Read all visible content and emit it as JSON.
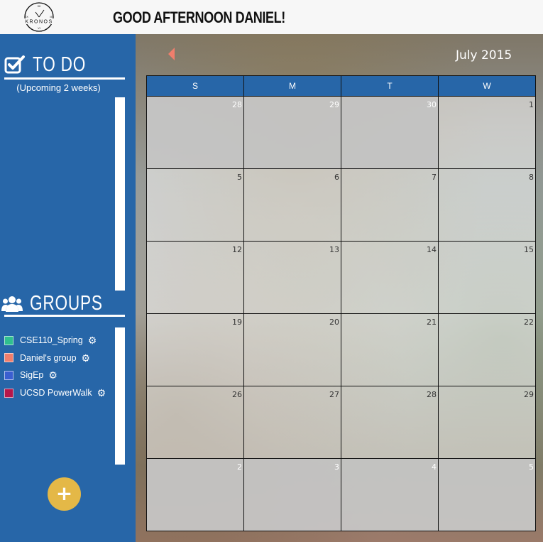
{
  "header": {
    "logo_word": "KRONOS",
    "logo_numerals": [
      "XII",
      "III",
      "VI",
      "IX"
    ],
    "greeting": "GOOD AFTERNOON DANIEL!"
  },
  "sidebar": {
    "todo": {
      "title": "TO DO",
      "subtitle": "(Upcoming 2 weeks)",
      "icon": "checkbox-icon"
    },
    "groups": {
      "title": "GROUPS",
      "icon": "users-icon",
      "items": [
        {
          "name": "CSE110_Spring",
          "color": "#2fbf8f"
        },
        {
          "name": "Daniel's group",
          "color": "#f07e6c"
        },
        {
          "name": "SigEp",
          "color": "#3b5fd0"
        },
        {
          "name": "UCSD PowerWalk",
          "color": "#b5164a"
        }
      ]
    },
    "add_button": {
      "label": "+",
      "color": "#e4b847"
    }
  },
  "calendar": {
    "month_title": "July 2015",
    "weekdays": [
      "S",
      "M",
      "T",
      "W"
    ],
    "weeks": [
      [
        {
          "day": "28",
          "muted": true
        },
        {
          "day": "29",
          "muted": true
        },
        {
          "day": "30",
          "muted": true
        },
        {
          "day": "1",
          "muted": false
        }
      ],
      [
        {
          "day": "5",
          "muted": false
        },
        {
          "day": "6",
          "muted": false
        },
        {
          "day": "7",
          "muted": false
        },
        {
          "day": "8",
          "muted": false
        }
      ],
      [
        {
          "day": "12",
          "muted": false
        },
        {
          "day": "13",
          "muted": false
        },
        {
          "day": "14",
          "muted": false
        },
        {
          "day": "15",
          "muted": false
        }
      ],
      [
        {
          "day": "19",
          "muted": false
        },
        {
          "day": "20",
          "muted": false
        },
        {
          "day": "21",
          "muted": false
        },
        {
          "day": "22",
          "muted": false
        }
      ],
      [
        {
          "day": "26",
          "muted": false
        },
        {
          "day": "27",
          "muted": false
        },
        {
          "day": "28",
          "muted": false
        },
        {
          "day": "29",
          "muted": false
        }
      ],
      [
        {
          "day": "2",
          "muted": true
        },
        {
          "day": "3",
          "muted": true
        },
        {
          "day": "4",
          "muted": true
        },
        {
          "day": "5",
          "muted": true
        }
      ]
    ]
  },
  "colors": {
    "primary": "#2766a8",
    "accent": "#e4b847",
    "arrow": "#f07e6c"
  }
}
